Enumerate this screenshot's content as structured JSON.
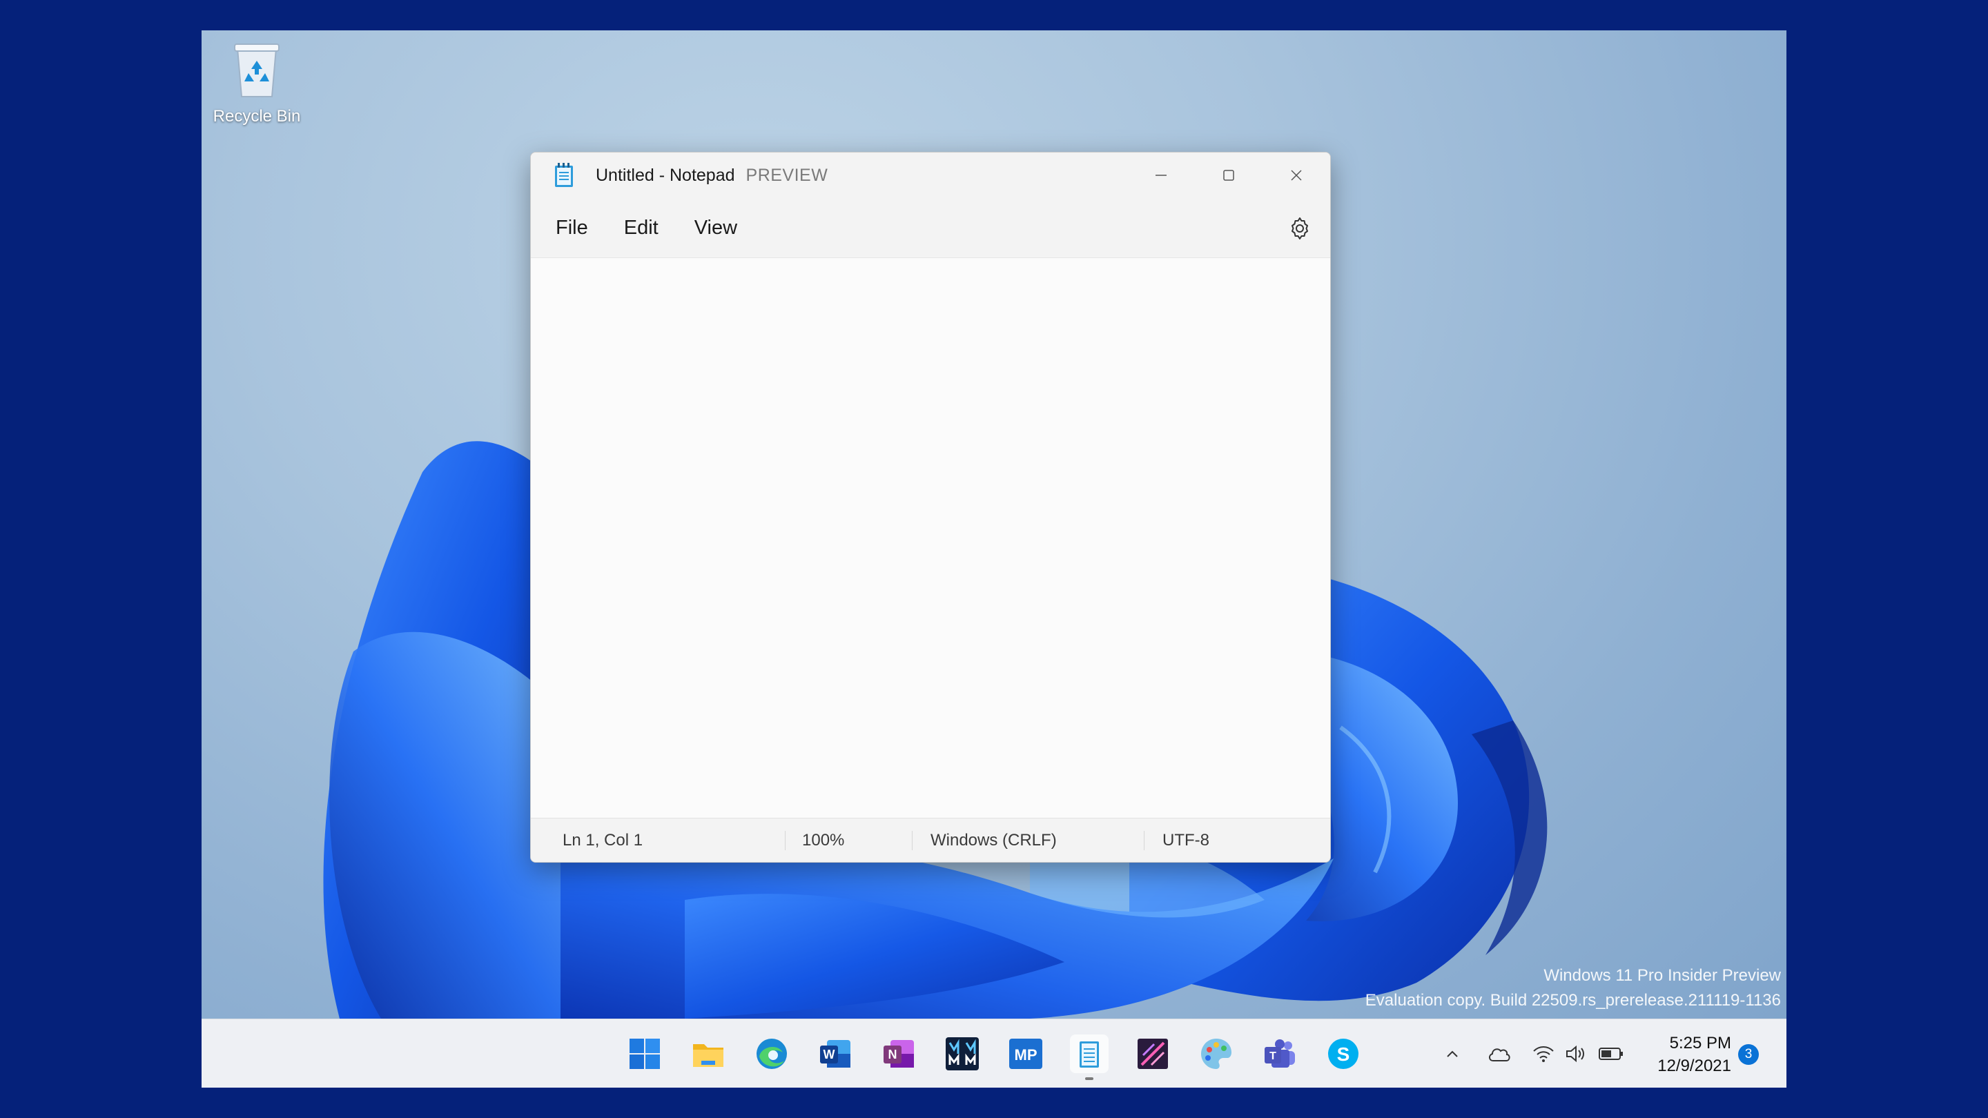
{
  "desktop": {
    "recycle_bin_label": "Recycle Bin",
    "watermark_line1": "Windows 11 Pro Insider Preview",
    "watermark_line2": "Evaluation copy. Build 22509.rs_prerelease.211119-1136"
  },
  "notepad": {
    "title": "Untitled - Notepad",
    "badge": "PREVIEW",
    "menus": [
      "File",
      "Edit",
      "View"
    ],
    "content": "",
    "status": {
      "position": "Ln 1, Col 1",
      "zoom": "100%",
      "line_ending": "Windows (CRLF)",
      "encoding": "UTF-8"
    }
  },
  "taskbar": {
    "apps": [
      "start-icon",
      "file-explorer-icon",
      "edge-icon",
      "word-icon",
      "onenote-icon",
      "app-mm-icon",
      "app-mp-icon",
      "notepad-icon",
      "paint-app-icon",
      "paint-palette-icon",
      "teams-icon",
      "skype-icon"
    ],
    "clock_time": "5:25 PM",
    "clock_date": "12/9/2021",
    "notification_count": "3"
  },
  "colors": {
    "accent": "#0a72d6",
    "frame": "#05217a"
  }
}
